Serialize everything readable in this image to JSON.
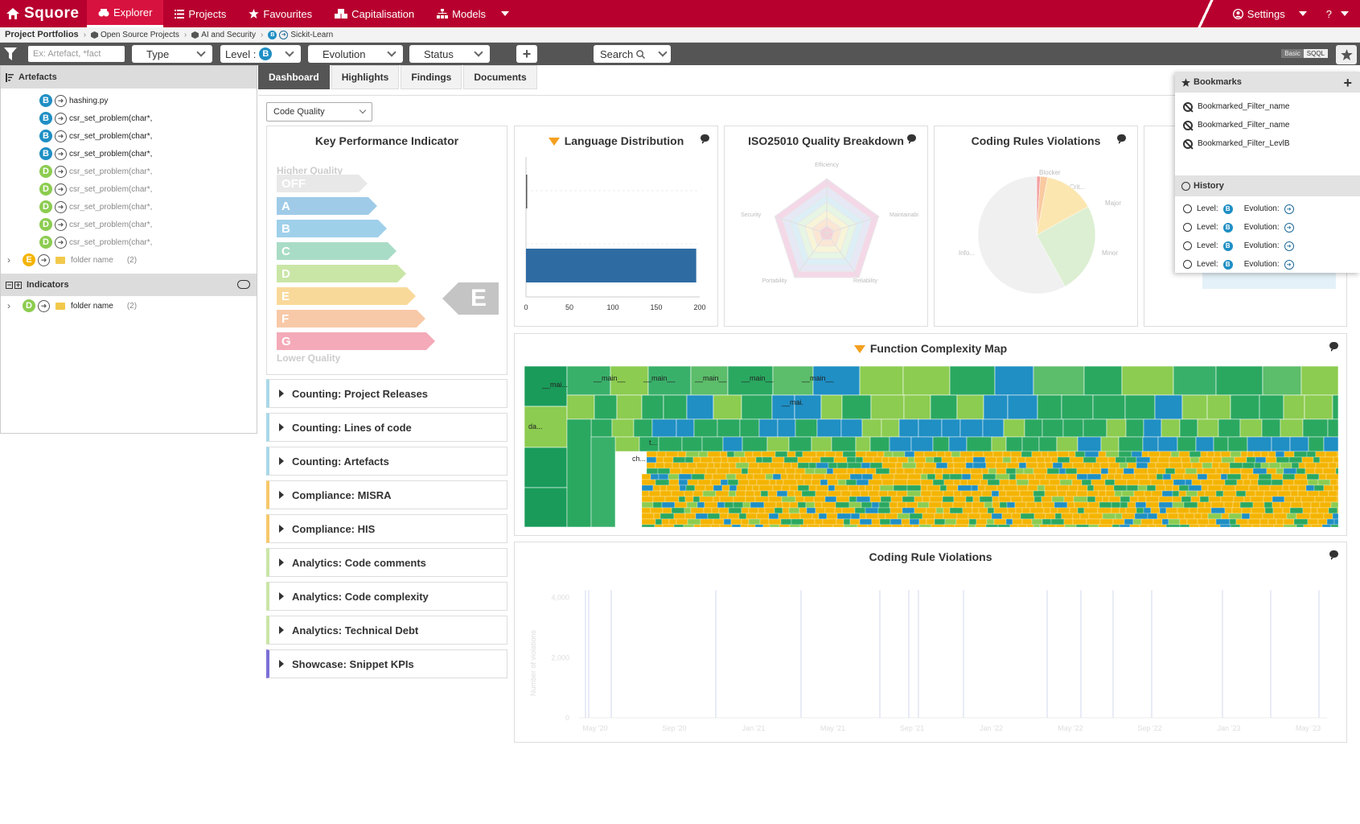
{
  "app": {
    "name": "Squore"
  },
  "nav": {
    "explorer": "Explorer",
    "projects": "Projects",
    "favourites": "Favourites",
    "capitalisation": "Capitalisation",
    "models": "Models",
    "settings": "Settings",
    "help": "?"
  },
  "breadcrumb": {
    "root": "Project Portfolios",
    "items": [
      "Open Source Projects",
      "AI and Security",
      "Sickit-Learn"
    ]
  },
  "filterbar": {
    "search_placeholder": "Ex: Artefact, *fact",
    "type": "Type",
    "level": "Level :",
    "level_value": "B",
    "evolution": "Evolution",
    "status": "Status",
    "search": "Search",
    "basic": "Basic",
    "sqql": "SQQL"
  },
  "artefacts": {
    "title": "Artefacts",
    "rows": [
      {
        "level": "B",
        "label": "hashing.py"
      },
      {
        "level": "B",
        "label": "csr_set_problem(char*,"
      },
      {
        "level": "B",
        "label": "csr_set_problem(char*,"
      },
      {
        "level": "B",
        "label": "csr_set_problem(char*,"
      },
      {
        "level": "D",
        "label": "csr_set_problem(char*,"
      },
      {
        "level": "D",
        "label": "csr_set_problem(char*,"
      },
      {
        "level": "D",
        "label": "csr_set_problem(char*,"
      },
      {
        "level": "D",
        "label": "csr_set_problem(char*,"
      },
      {
        "level": "D",
        "label": "csr_set_problem(char*,"
      }
    ],
    "folder": {
      "level": "E",
      "label": "folder name",
      "count": "(2)"
    }
  },
  "indicators": {
    "title": "Indicators",
    "folder": {
      "level": "D",
      "label": "folder name",
      "count": "(2)"
    }
  },
  "tabs": [
    "Dashboard",
    "Highlights",
    "Findings",
    "Documents"
  ],
  "dashboard_select": "Code Quality",
  "kpi": {
    "title": "Key Performance Indicator",
    "higher": "Higher Quality",
    "lower": "Lower Quality",
    "levels": [
      "OFF",
      "A",
      "B",
      "C",
      "D",
      "E",
      "F",
      "G"
    ],
    "current": "E",
    "colors": [
      "#e8e8e8",
      "#9fcbe8",
      "#9fd0ea",
      "#a9dcc6",
      "#c9e6a6",
      "#f9d99a",
      "#f8c9a8",
      "#f4aab8"
    ]
  },
  "collapsibles": [
    {
      "label": "Counting: Project Releases",
      "color": "#a8d8e8"
    },
    {
      "label": "Counting: Lines of code",
      "color": "#a8d8e8"
    },
    {
      "label": "Counting: Artefacts",
      "color": "#a8d8e8"
    },
    {
      "label": "Compliance: MISRA",
      "color": "#f6c86a"
    },
    {
      "label": "Compliance: HIS",
      "color": "#f6c86a"
    },
    {
      "label": "Analytics: Code comments",
      "color": "#c9e6a6"
    },
    {
      "label": "Analytics: Code complexity",
      "color": "#c9e6a6"
    },
    {
      "label": "Analytics: Technical Debt",
      "color": "#c9e6a6"
    },
    {
      "label": "Showcase: Snippet KPIs",
      "color": "#7b6fd6"
    }
  ],
  "cards": {
    "language": "Language Distribution",
    "iso": "ISO25010 Quality Breakdown",
    "coding": "Coding Rules Violations",
    "complexity": "Function Complexity Map",
    "violations": "Coding Rule Violations"
  },
  "chart_data": [
    {
      "type": "bar",
      "title": "Language Distribution",
      "orientation": "horizontal",
      "series": [
        {
          "values": [
            1,
            196
          ]
        }
      ],
      "xlim": [
        0,
        200
      ],
      "xticks": [
        "0",
        "50",
        "100",
        "150",
        "200"
      ],
      "color": "#2e6ba3"
    },
    {
      "type": "radar",
      "title": "ISO25010 Quality Breakdown",
      "axes": [
        "Efficiency",
        "Maintainabi",
        "Reliability",
        "Portability",
        "Security"
      ]
    },
    {
      "type": "pie",
      "title": "Coding Rules Violations",
      "slices": [
        {
          "label": "Blocker",
          "value": 1,
          "color": "#f4a0a0"
        },
        {
          "label": "Crit...",
          "value": 2,
          "color": "#f9c9a0"
        },
        {
          "label": "Major",
          "value": 14,
          "color": "#fce6b0"
        },
        {
          "label": "Minor",
          "value": 25,
          "color": "#dcefd2"
        },
        {
          "label": "Info...",
          "value": 58,
          "color": "#f0f0f0"
        }
      ]
    },
    {
      "type": "heatmap",
      "title": "Function Complexity Map",
      "labels": [
        "__main__",
        "__main__",
        "__main__",
        "__main__",
        "__main__",
        "__mai.",
        "__mai...",
        "da...",
        "ch...",
        "t..."
      ]
    },
    {
      "type": "line",
      "title": "Coding Rule Violations",
      "ylabel": "Number of violations",
      "ylim": [
        0,
        4500
      ],
      "yticks": [
        "4,000",
        "2,000",
        "0"
      ],
      "xticks": [
        "May '20",
        "Sep '20",
        "Jan '21",
        "May '21",
        "Sep '21",
        "Jan '22",
        "May '22",
        "Sep '22",
        "Jan '23",
        "May '23"
      ]
    }
  ],
  "bookmarks": {
    "title": "Bookmarks",
    "items": [
      "Bookmarked_Filter_name",
      "Bookmarked_Filter_name",
      "Bookmarked_Filter_LevlB"
    ]
  },
  "history": {
    "title": "History",
    "level": "Level:",
    "level_value": "B",
    "evolution": "Evolution:",
    "count": 4
  }
}
